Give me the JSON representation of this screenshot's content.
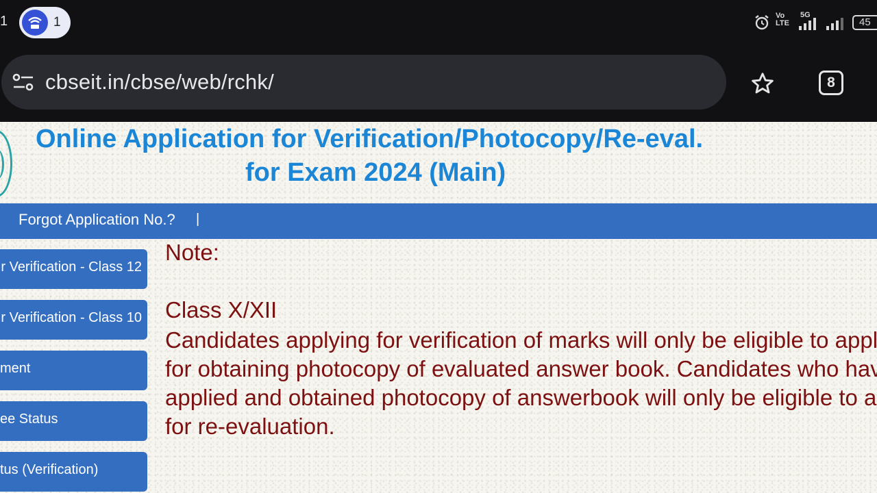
{
  "status_bar": {
    "left_number": "1",
    "hotspot_count": "1",
    "network_label": "Vo\nLTE",
    "network_type": "5G",
    "battery": "45"
  },
  "browser": {
    "url": "cbseit.in/cbse/web/rchk/",
    "tab_count": "8"
  },
  "header": {
    "title_line1": "Online Application for Verification/Photocopy/Re-eval.",
    "title_line2": "for Exam 2024 (Main)"
  },
  "nav": {
    "forgot_link": "Forgot Application No.?",
    "separator": "|"
  },
  "sidebar": {
    "items": [
      {
        "label": "r Verification - Class 12"
      },
      {
        "label": "r Verification - Class 10"
      },
      {
        "label": "ment"
      },
      {
        "label": "ee Status"
      },
      {
        "label": "tus (Verification)"
      }
    ]
  },
  "content": {
    "note_heading": "Note:",
    "class_label": "Class X/XII",
    "paragraph": "Candidates applying for verification of marks will only be eligible to apply for obtaining photocopy of evaluated answer book. Candidates who have applied and obtained photocopy of answerbook will only be eligible to apply for re-evaluation."
  },
  "colors": {
    "title_blue": "#1b86d6",
    "nav_blue": "#346ec1",
    "note_red": "#7d1010"
  }
}
